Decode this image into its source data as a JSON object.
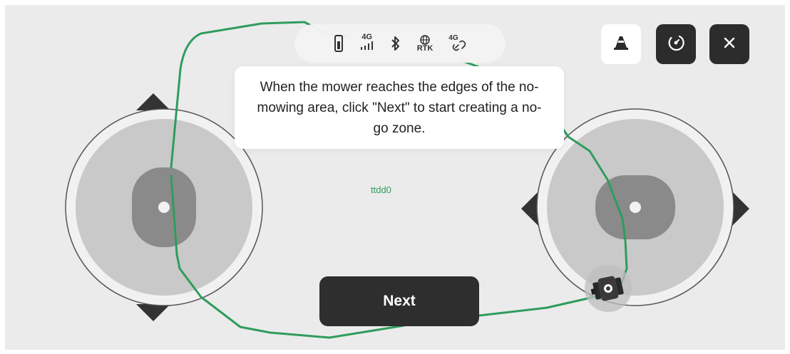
{
  "status_bar": {
    "icons": [
      "battery-icon",
      "cellular-4g-icon",
      "bluetooth-icon",
      "rtk-icon",
      "link-4g-icon"
    ],
    "cellular_label": "4G",
    "rtk_label": "RTK",
    "link_label": "4G"
  },
  "tooltip": {
    "text": "When the mower reaches the edges of the no-mowing area, click \"Next\" to start creating a no-go zone."
  },
  "map": {
    "label": "ttdd0",
    "path_color": "#2f9c5c"
  },
  "toolbar": {
    "cone_icon": "traffic-cone-icon",
    "recenter_icon": "recenter-icon",
    "close_icon": "close-icon"
  },
  "actions": {
    "next_label": "Next"
  },
  "colors": {
    "background": "#ebebec",
    "dark_button": "#2c2c2c",
    "joystick_outer": "#c9c9c9",
    "joystick_knob": "#8a8a8a"
  }
}
